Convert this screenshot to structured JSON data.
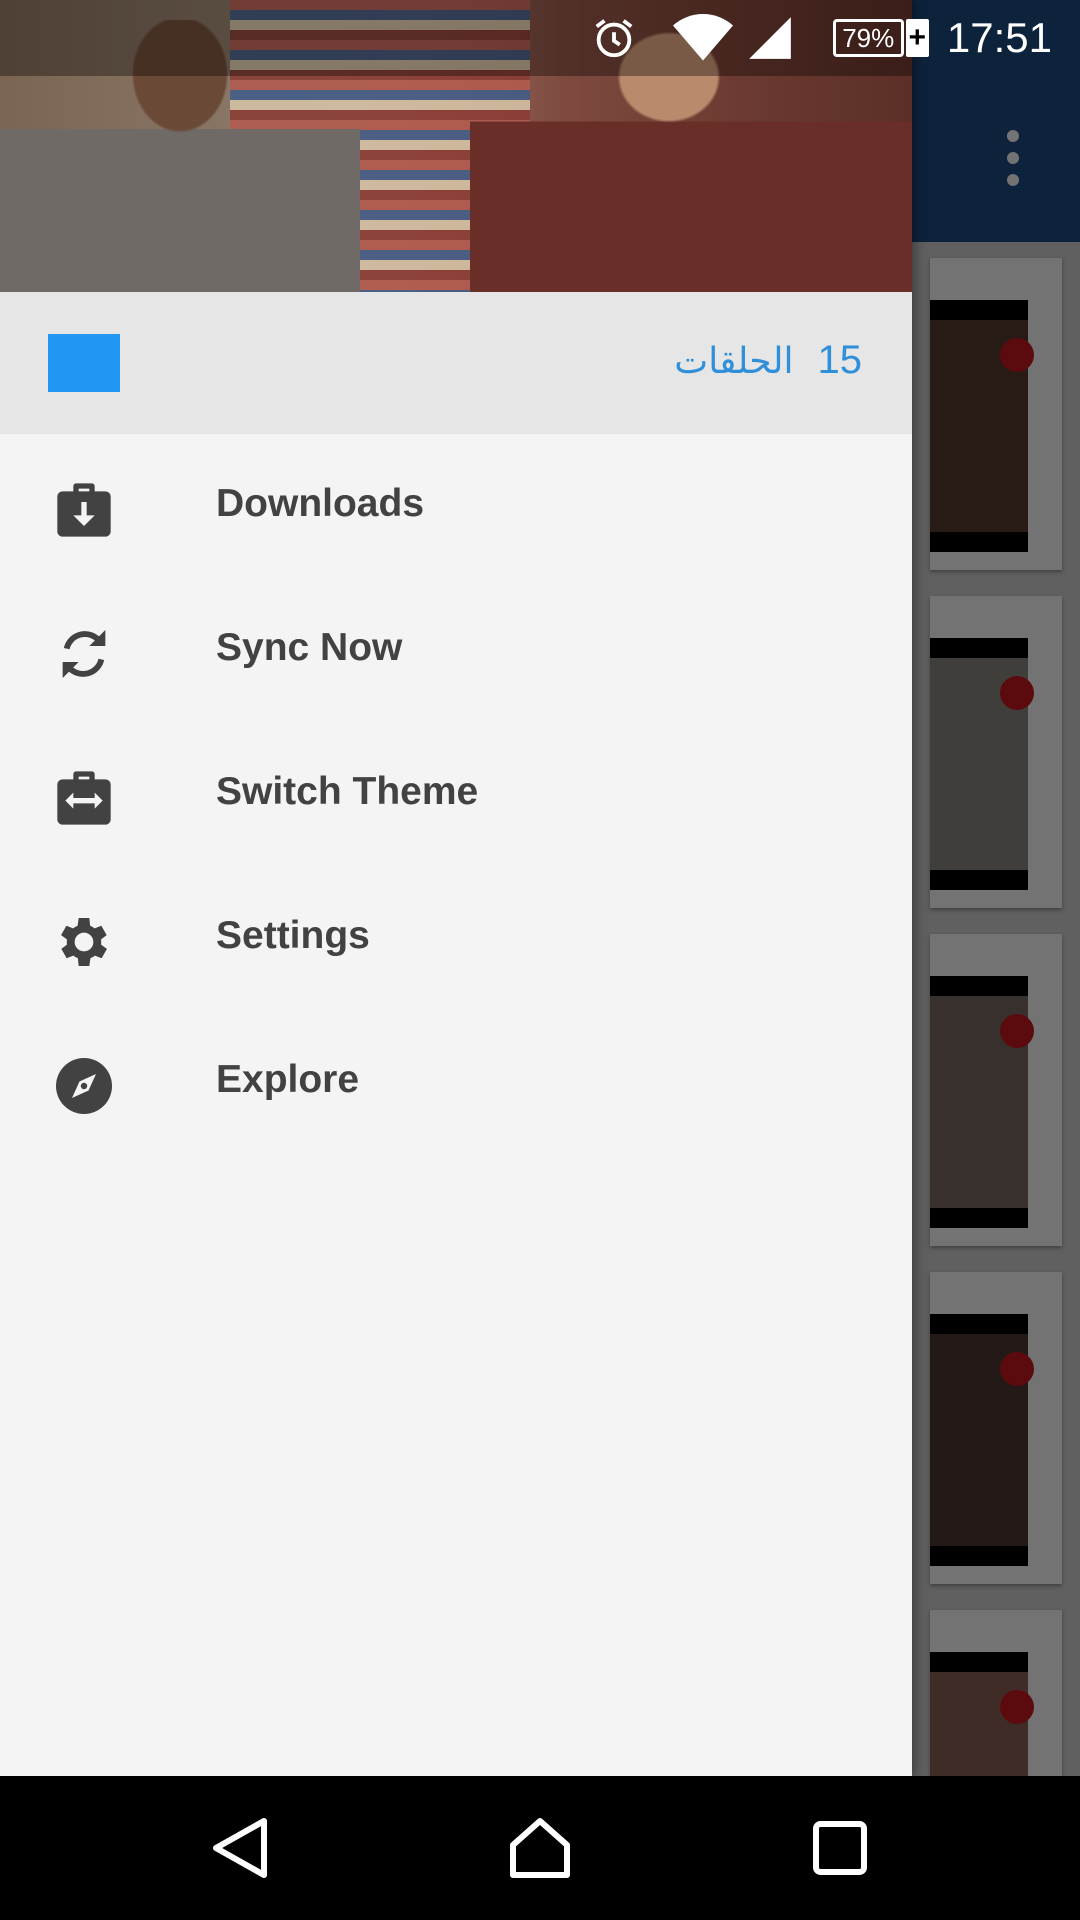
{
  "status_bar": {
    "time": "17:51",
    "battery_percent": "79%",
    "battery_charging_symbol": "+",
    "icons": [
      "alarm-icon",
      "wifi-icon",
      "signal-icon",
      "battery-icon"
    ]
  },
  "drawer": {
    "header_image": "show-banner-image",
    "episodes": {
      "count": "15",
      "label": "الحلقات",
      "accent_color": "#2196f3",
      "text_color": "#2f8fd8"
    },
    "menu": [
      {
        "label": "Downloads",
        "icon": "download-briefcase-icon"
      },
      {
        "label": "Sync Now",
        "icon": "sync-icon"
      },
      {
        "label": "Switch Theme",
        "icon": "switch-theme-icon"
      },
      {
        "label": "Settings",
        "icon": "gear-icon"
      },
      {
        "label": "Explore",
        "icon": "compass-icon"
      }
    ]
  },
  "background_app": {
    "toolbar_color": "#1d4f86",
    "overflow_icon": "more-vert-icon",
    "episode_cards": 5
  },
  "nav_bar": {
    "buttons": [
      "back-icon",
      "home-icon",
      "recents-icon"
    ]
  }
}
